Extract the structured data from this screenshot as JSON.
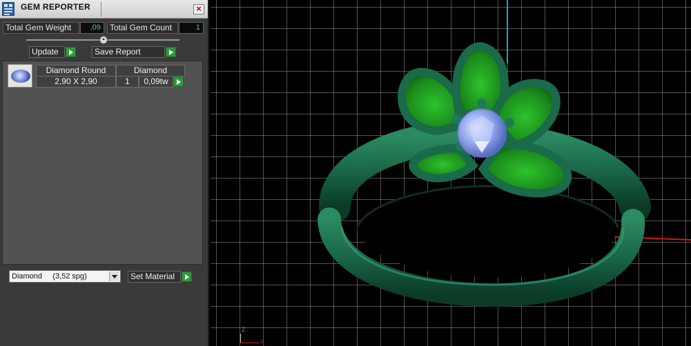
{
  "window": {
    "title": "GEM REPORTER"
  },
  "totals": {
    "weight_label": "Total Gem Weight",
    "weight_value": ",09",
    "count_label": "Total Gem Count",
    "count_value": "1"
  },
  "actions": {
    "update_label": "Update",
    "save_report_label": "Save Report"
  },
  "gem_list": {
    "items": [
      {
        "icon": "round-diamond-thumbnail",
        "name": "Diamond Round",
        "material": "Diamond",
        "size": "2,90 X 2,90",
        "count": "1",
        "weight": "0,09tw"
      }
    ]
  },
  "material": {
    "selected": "Diamond     (3,52 spg)",
    "set_label": "Set Material"
  },
  "viewport": {
    "axis_z_label": "Z",
    "axis_x_label": "X",
    "grid": true,
    "colors": {
      "metal": "#1f6b4a",
      "petal_fill": "#1f8a1f",
      "stone": "#8fa6ee",
      "axis_vertical": "#1ca6b8",
      "axis_horizontal": "#d21a1a"
    }
  },
  "colors": {
    "panel_bg": "#3a3a3a",
    "accent_green": "#2f9a3a",
    "value_text": "#4fb6d8"
  }
}
